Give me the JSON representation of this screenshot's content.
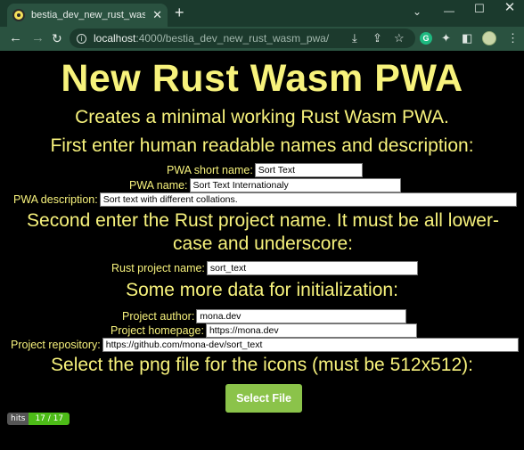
{
  "browser": {
    "tab_title": "bestia_dev_new_rust_wasm_pwa",
    "tab_close": "✕",
    "new_tab": "+",
    "url_host": "localhost",
    "url_path": ":4000/bestia_dev_new_rust_wasm_pwa/",
    "icons": [
      "back-arrow-icon",
      "forward-arrow-icon",
      "reload-icon",
      "site-info-icon",
      "install-app-icon",
      "share-icon",
      "bookmark-star-icon",
      "extension-g-icon",
      "puzzle-extensions-icon",
      "side-panel-icon",
      "profile-avatar-icon",
      "menu-kebab-icon"
    ]
  },
  "page": {
    "title": "New Rust Wasm PWA",
    "subtitle": "Creates a minimal working Rust Wasm PWA.",
    "section1": "First enter human readable names and description:",
    "section2": "Second enter the Rust project name. It must be all lower-case and underscore:",
    "section3": "Some more data for initialization:",
    "section4": "Select the png file for the icons (must be 512x512):",
    "fields": {
      "pwa_short_name": {
        "label": "PWA short name:",
        "value": "Sort Text"
      },
      "pwa_name": {
        "label": "PWA name:",
        "value": "Sort Text Internationaly"
      },
      "pwa_description": {
        "label": "PWA description:",
        "value": "Sort text with different collations."
      },
      "rust_project_name": {
        "label": "Rust project name:",
        "value": "sort_text"
      },
      "project_author": {
        "label": "Project author:",
        "value": "mona.dev"
      },
      "project_homepage": {
        "label": "Project homepage:",
        "value": "https://mona.dev"
      },
      "project_repository": {
        "label": "Project repository:",
        "value": "https://github.com/mona-dev/sort_text"
      }
    },
    "select_file_button": "Select File",
    "hits_label": "hits",
    "hits_value": "17 / 17"
  },
  "colors": {
    "accent_text": "#f7f27c",
    "button": "#8bc34a",
    "chrome_dark": "#1b3a2d",
    "chrome": "#2a5240"
  }
}
